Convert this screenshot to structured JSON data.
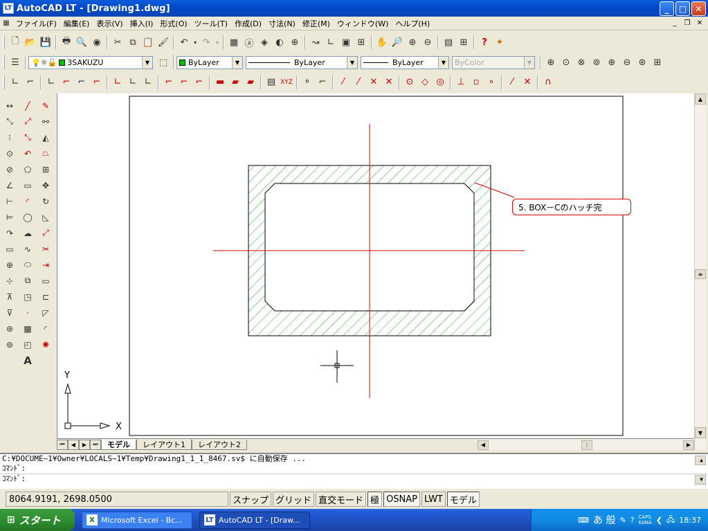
{
  "window": {
    "title": "AutoCAD LT - [Drawing1.dwg]",
    "icon": "autocad-lt-icon"
  },
  "menu": [
    "ファイル(F)",
    "編集(E)",
    "表示(V)",
    "挿入(I)",
    "形式(O)",
    "ツール(T)",
    "作成(D)",
    "寸法(N)",
    "修正(M)",
    "ウィンドウ(W)",
    "ヘルプ(H)"
  ],
  "properties": {
    "layer": "3SAKUZU",
    "color": "ByLayer",
    "linetype": "ByLayer",
    "lineweight": "ByLayer",
    "plotstyle": "ByColor"
  },
  "drawing": {
    "callout": "5. BOX－Cのハッチ完",
    "ucs_y": "Y",
    "ucs_x": "X",
    "hatch_color": "#23b023",
    "axis_color": "#e00000"
  },
  "tabs": [
    "モデル",
    "レイアウト1",
    "レイアウト2"
  ],
  "command": {
    "line1": "C:¥DOCUME~1¥Owner¥LOCALS~1¥Temp¥Drawing1_1_1_8467.sv$ に自動保存 ...",
    "line2": "ｺﾏﾝﾄﾞ:",
    "line3": "ｺﾏﾝﾄﾞ:"
  },
  "status": {
    "coords": "8064.9191,  2698.0500",
    "buttons": [
      "スナップ",
      "グリッド",
      "直交モード",
      "極",
      "OSNAP",
      "LWT",
      "モデル"
    ]
  },
  "taskbar": {
    "start": "スタート",
    "tasks": [
      "Microsoft Excel - Bc...",
      "AutoCAD LT - [Draw..."
    ],
    "ime": "あ 般",
    "caps": "CAPS",
    "kana": "KANA",
    "clock": "18:37"
  }
}
